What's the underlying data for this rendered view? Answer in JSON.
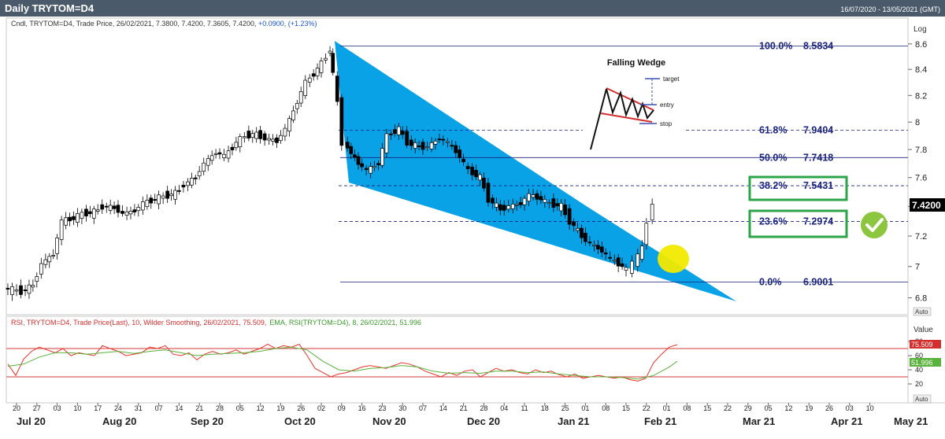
{
  "header": {
    "title": "Daily TRYTOM=D4",
    "date_range": "16/07/2020 - 13/05/2021 (GMT)",
    "title_bar_color": "#4a5a6b"
  },
  "price_panel": {
    "legend_prefix": "Cndl, TRYTOM=D4, Trade Price, 26/02/2021, 7.3800, 7.4200, 7.3605, 7.4200, ",
    "legend_change": "+0.0900, (+1.23%)",
    "scale_label": "Log",
    "last_price_label": "7.4200",
    "auto_label": "Auto"
  },
  "rsi_panel": {
    "legend_rsi": "RSI, TRYTOM=D4, Trade Price(Last),  10, Wilder Smoothing, 26/02/2021, 75.509,",
    "legend_ema": "EMA, RSI(TRYTOM=D4),  8, 26/02/2021, 51.996",
    "value_label": "Value",
    "rsi_last_label": "75.509",
    "ema_last_label": "51.996",
    "auto_label": "Auto"
  },
  "annotations": {
    "wedge_title": "Falling Wedge",
    "target_label": "target",
    "entry_label": "entry",
    "stop_label": "stop"
  },
  "colors": {
    "wedge_fill": "#0aa2e6",
    "highlight_circle": "#f2ea00",
    "box_green": "#2ca54a",
    "check_green": "#8cc63f",
    "fib_line": "#1a237e",
    "candle_up": "#ffffff",
    "candle_down": "#000000",
    "rsi_line": "#e8332a",
    "ema_line": "#59b33b",
    "rsi_band": "#d23a3a"
  },
  "chart_data": [
    {
      "type": "candlestick",
      "y_scale": "log",
      "ylim": [
        6.75,
        8.7
      ],
      "y_ticks": [
        "6.8",
        "7",
        "7.2",
        "7.4",
        "7.6",
        "7.8",
        "8",
        "8.2",
        "8.4",
        "8.6"
      ],
      "x_ticks": [
        "20",
        "27",
        "03",
        "10",
        "17",
        "24",
        "31",
        "07",
        "14",
        "21",
        "28",
        "05",
        "12",
        "19",
        "26",
        "02",
        "09",
        "16",
        "23",
        "30",
        "07",
        "14",
        "21",
        "28",
        "04",
        "11",
        "18",
        "25",
        "01",
        "08",
        "15",
        "22",
        "01",
        "08",
        "15",
        "22",
        "29",
        "05",
        "12",
        "19",
        "26",
        "03",
        "10"
      ],
      "month_labels": [
        "Jul 20",
        "Aug 20",
        "Sep 20",
        "Oct 20",
        "Nov 20",
        "Dec 20",
        "Jan 21",
        "Feb 21",
        "Mar 21",
        "Apr 21",
        "May 21"
      ],
      "fibonacci": [
        {
          "pct": "100.0%",
          "level": "8.5834"
        },
        {
          "pct": "61.8%",
          "level": "7.9404"
        },
        {
          "pct": "50.0%",
          "level": "7.7418"
        },
        {
          "pct": "38.2%",
          "level": "7.5431"
        },
        {
          "pct": "23.6%",
          "level": "7.2974"
        },
        {
          "pct": "0.0%",
          "level": "6.9001"
        }
      ],
      "close_series": [
        [
          "2020-07-17",
          6.86
        ],
        [
          "2020-07-20",
          6.85
        ],
        [
          "2020-07-23",
          6.84
        ],
        [
          "2020-07-27",
          6.88
        ],
        [
          "2020-07-30",
          7.02
        ],
        [
          "2020-08-03",
          7.08
        ],
        [
          "2020-08-06",
          7.3
        ],
        [
          "2020-08-10",
          7.32
        ],
        [
          "2020-08-13",
          7.35
        ],
        [
          "2020-08-17",
          7.36
        ],
        [
          "2020-08-20",
          7.4
        ],
        [
          "2020-08-24",
          7.39
        ],
        [
          "2020-08-27",
          7.35
        ],
        [
          "2020-08-31",
          7.37
        ],
        [
          "2020-09-03",
          7.42
        ],
        [
          "2020-09-07",
          7.45
        ],
        [
          "2020-09-10",
          7.47
        ],
        [
          "2020-09-14",
          7.49
        ],
        [
          "2020-09-17",
          7.55
        ],
        [
          "2020-09-21",
          7.6
        ],
        [
          "2020-09-24",
          7.7
        ],
        [
          "2020-09-28",
          7.78
        ],
        [
          "2020-10-01",
          7.75
        ],
        [
          "2020-10-05",
          7.85
        ],
        [
          "2020-10-08",
          7.9
        ],
        [
          "2020-10-12",
          7.91
        ],
        [
          "2020-10-15",
          7.88
        ],
        [
          "2020-10-19",
          7.86
        ],
        [
          "2020-10-22",
          7.95
        ],
        [
          "2020-10-26",
          8.15
        ],
        [
          "2020-10-29",
          8.3
        ],
        [
          "2020-11-02",
          8.4
        ],
        [
          "2020-11-05",
          8.5
        ],
        [
          "2020-11-06",
          8.56
        ],
        [
          "2020-11-09",
          8.15
        ],
        [
          "2020-11-11",
          7.85
        ],
        [
          "2020-11-16",
          7.7
        ],
        [
          "2020-11-19",
          7.65
        ],
        [
          "2020-11-23",
          7.7
        ],
        [
          "2020-11-26",
          7.9
        ],
        [
          "2020-11-30",
          7.95
        ],
        [
          "2020-12-03",
          7.85
        ],
        [
          "2020-12-07",
          7.82
        ],
        [
          "2020-12-10",
          7.82
        ],
        [
          "2020-12-14",
          7.88
        ],
        [
          "2020-12-17",
          7.85
        ],
        [
          "2020-12-21",
          7.75
        ],
        [
          "2020-12-24",
          7.65
        ],
        [
          "2020-12-28",
          7.6
        ],
        [
          "2020-12-31",
          7.45
        ],
        [
          "2021-01-04",
          7.38
        ],
        [
          "2021-01-07",
          7.4
        ],
        [
          "2021-01-11",
          7.42
        ],
        [
          "2021-01-14",
          7.48
        ],
        [
          "2021-01-18",
          7.45
        ],
        [
          "2021-01-21",
          7.42
        ],
        [
          "2021-01-25",
          7.4
        ],
        [
          "2021-01-28",
          7.3
        ],
        [
          "2021-02-01",
          7.2
        ],
        [
          "2021-02-04",
          7.15
        ],
        [
          "2021-02-08",
          7.1
        ],
        [
          "2021-02-11",
          7.05
        ],
        [
          "2021-02-15",
          7.0
        ],
        [
          "2021-02-17",
          6.98
        ],
        [
          "2021-02-19",
          7.02
        ],
        [
          "2021-02-22",
          7.12
        ],
        [
          "2021-02-24",
          7.3
        ],
        [
          "2021-02-26",
          7.42
        ]
      ]
    },
    {
      "type": "line",
      "title": "RSI",
      "ylim": [
        0,
        100
      ],
      "y_ticks": [
        "20",
        "40",
        "60",
        "80"
      ],
      "bands": [
        70,
        30
      ],
      "series": [
        {
          "name": "RSI",
          "values": [
            [
              0,
              48
            ],
            [
              2,
              32
            ],
            [
              4,
              55
            ],
            [
              6,
              66
            ],
            [
              8,
              72
            ],
            [
              10,
              68
            ],
            [
              12,
              64
            ],
            [
              14,
              70
            ],
            [
              16,
              60
            ],
            [
              18,
              64
            ],
            [
              20,
              62
            ],
            [
              22,
              60
            ],
            [
              24,
              74
            ],
            [
              26,
              70
            ],
            [
              28,
              66
            ],
            [
              30,
              60
            ],
            [
              32,
              62
            ],
            [
              34,
              64
            ],
            [
              36,
              72
            ],
            [
              38,
              70
            ],
            [
              40,
              74
            ],
            [
              42,
              62
            ],
            [
              44,
              60
            ],
            [
              46,
              64
            ],
            [
              48,
              54
            ],
            [
              50,
              62
            ],
            [
              52,
              66
            ],
            [
              54,
              62
            ],
            [
              56,
              64
            ],
            [
              58,
              68
            ],
            [
              60,
              62
            ],
            [
              62,
              66
            ],
            [
              64,
              70
            ],
            [
              66,
              76
            ],
            [
              68,
              70
            ],
            [
              70,
              74
            ],
            [
              72,
              72
            ],
            [
              74,
              76
            ],
            [
              76,
              60
            ],
            [
              78,
              42
            ],
            [
              80,
              36
            ],
            [
              82,
              30
            ],
            [
              84,
              34
            ],
            [
              86,
              36
            ],
            [
              88,
              40
            ],
            [
              90,
              44
            ],
            [
              92,
              46
            ],
            [
              94,
              44
            ],
            [
              96,
              42
            ],
            [
              98,
              46
            ],
            [
              100,
              50
            ],
            [
              102,
              48
            ],
            [
              104,
              44
            ],
            [
              106,
              38
            ],
            [
              108,
              34
            ],
            [
              110,
              30
            ],
            [
              112,
              36
            ],
            [
              114,
              32
            ],
            [
              116,
              38
            ],
            [
              118,
              40
            ],
            [
              120,
              30
            ],
            [
              122,
              36
            ],
            [
              124,
              42
            ],
            [
              126,
              38
            ],
            [
              128,
              40
            ],
            [
              130,
              36
            ],
            [
              132,
              34
            ],
            [
              134,
              40
            ],
            [
              136,
              36
            ],
            [
              138,
              38
            ],
            [
              140,
              33
            ],
            [
              142,
              30
            ],
            [
              144,
              34
            ],
            [
              146,
              28
            ],
            [
              148,
              30
            ],
            [
              150,
              32
            ],
            [
              152,
              30
            ],
            [
              154,
              28
            ],
            [
              156,
              30
            ],
            [
              158,
              26
            ],
            [
              160,
              24
            ],
            [
              162,
              28
            ],
            [
              164,
              50
            ],
            [
              166,
              62
            ],
            [
              168,
              72
            ],
            [
              170,
              75.5
            ]
          ]
        },
        {
          "name": "EMA",
          "values": [
            [
              0,
              45
            ],
            [
              4,
              48
            ],
            [
              8,
              58
            ],
            [
              12,
              64
            ],
            [
              16,
              64
            ],
            [
              20,
              62
            ],
            [
              24,
              64
            ],
            [
              28,
              66
            ],
            [
              32,
              63
            ],
            [
              36,
              66
            ],
            [
              40,
              68
            ],
            [
              44,
              64
            ],
            [
              48,
              60
            ],
            [
              52,
              62
            ],
            [
              56,
              63
            ],
            [
              60,
              64
            ],
            [
              64,
              66
            ],
            [
              68,
              70
            ],
            [
              72,
              72
            ],
            [
              76,
              68
            ],
            [
              80,
              52
            ],
            [
              84,
              40
            ],
            [
              88,
              38
            ],
            [
              92,
              42
            ],
            [
              96,
              43
            ],
            [
              100,
              46
            ],
            [
              104,
              44
            ],
            [
              108,
              38
            ],
            [
              112,
              35
            ],
            [
              116,
              36
            ],
            [
              120,
              35
            ],
            [
              124,
              38
            ],
            [
              128,
              38
            ],
            [
              132,
              36
            ],
            [
              136,
              37
            ],
            [
              140,
              34
            ],
            [
              144,
              32
            ],
            [
              148,
              30
            ],
            [
              152,
              30
            ],
            [
              156,
              29
            ],
            [
              160,
              27
            ],
            [
              164,
              32
            ],
            [
              168,
              44
            ],
            [
              170,
              52
            ]
          ]
        }
      ]
    }
  ]
}
